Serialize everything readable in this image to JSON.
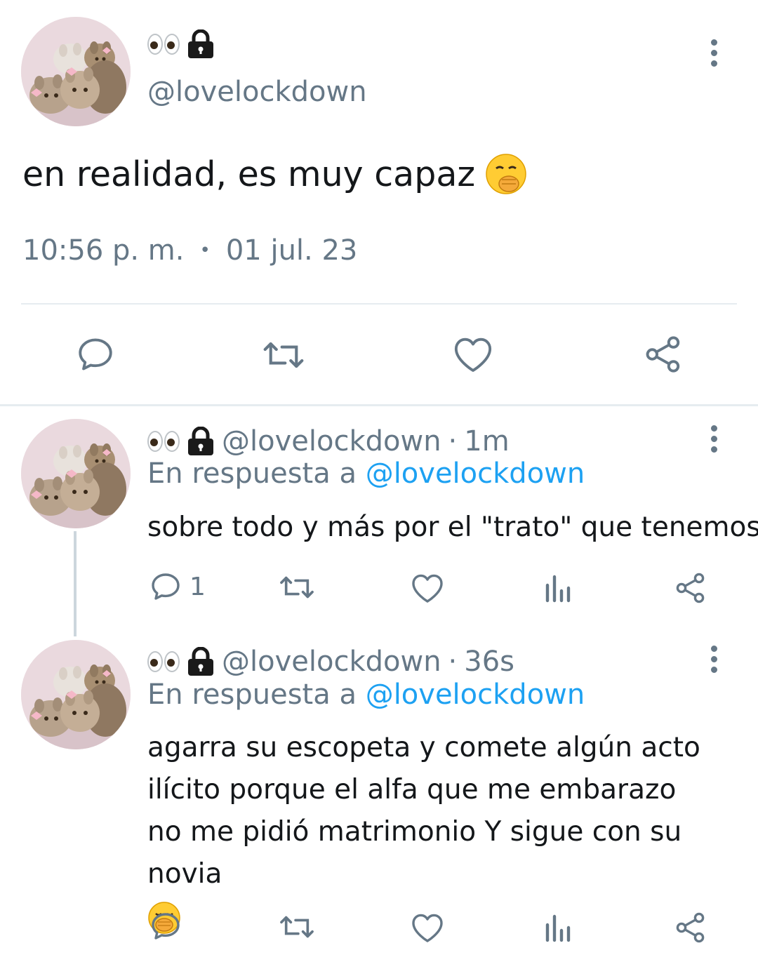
{
  "main_tweet": {
    "handle": "@lovelockdown",
    "text": "en realidad, es muy capaz",
    "time": "10:56 p. m.",
    "separator": "•",
    "date": "01 jul. 23"
  },
  "replies": [
    {
      "handle": "@lovelockdown",
      "time_sep": "·",
      "age": "1m",
      "reply_prefix": "En respuesta a",
      "reply_mention": "@lovelockdown",
      "text": "sobre todo y más por el \"trato\" que tenemos",
      "reply_count": "1"
    },
    {
      "handle": "@lovelockdown",
      "time_sep": "·",
      "age": "36s",
      "reply_prefix": "En respuesta a",
      "reply_mention": "@lovelockdown",
      "text": "agarra su escopeta y comete algún acto ilícito porque el alfa que me embarazo no me pidió matrimonio Y sigue con su novia"
    }
  ],
  "icons": {
    "reply": "reply-icon",
    "retweet": "retweet-icon",
    "like": "heart-icon",
    "analytics": "analytics-icon",
    "share": "share-icon",
    "more": "more-options-icon",
    "lock": "lock-icon",
    "eyes": "eyes-emoji-icon"
  },
  "colors": {
    "text_primary": "#14171a",
    "text_secondary": "#657786",
    "mention": "#1da1f2",
    "divider": "#e6ecf0"
  }
}
